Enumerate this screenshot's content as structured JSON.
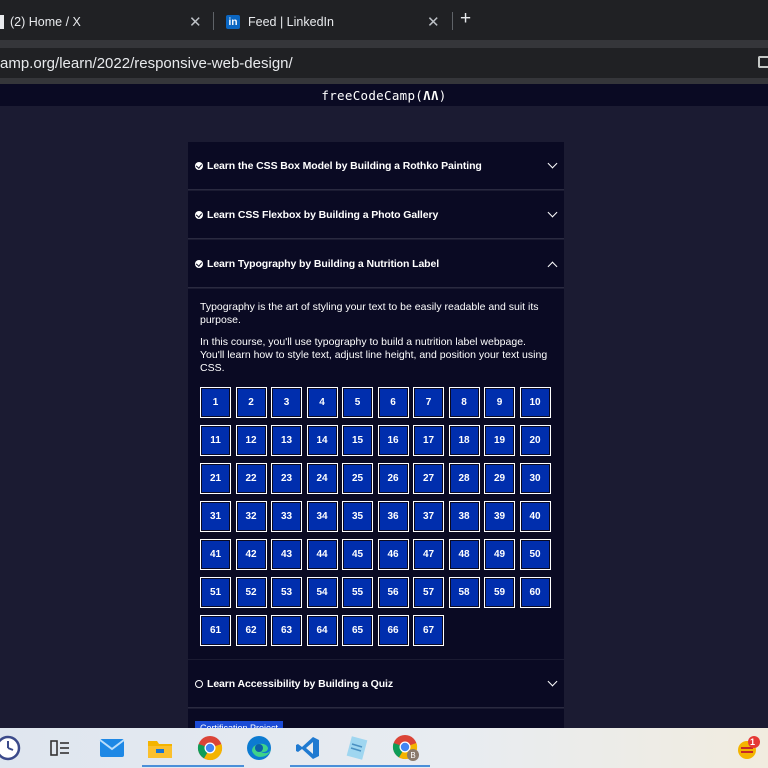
{
  "browser": {
    "tabs": [
      {
        "title": "(2) Home / X",
        "icon": "x-logo-icon"
      },
      {
        "title": "Feed | LinkedIn",
        "icon": "linkedin-icon"
      }
    ],
    "url": "amp.org/learn/2022/responsive-web-design/"
  },
  "site": {
    "logo": "freeCodeCamp(🔥)"
  },
  "blocks": [
    {
      "title": "Learn the CSS Box Model by Building a Rothko Painting",
      "status": "complete",
      "expanded": false
    },
    {
      "title": "Learn CSS Flexbox by Building a Photo Gallery",
      "status": "complete",
      "expanded": false
    },
    {
      "title": "Learn Typography by Building a Nutrition Label",
      "status": "complete",
      "expanded": true,
      "description": [
        "Typography is the art of styling your text to be easily readable and suit its purpose.",
        "In this course, you'll use typography to build a nutrition label webpage. You'll learn how to style text, adjust line height, and position your text using CSS."
      ],
      "steps": [
        "1",
        "2",
        "3",
        "4",
        "5",
        "6",
        "7",
        "8",
        "9",
        "10",
        "11",
        "12",
        "13",
        "14",
        "15",
        "16",
        "17",
        "18",
        "19",
        "20",
        "21",
        "22",
        "23",
        "24",
        "25",
        "26",
        "27",
        "28",
        "29",
        "30",
        "31",
        "32",
        "33",
        "34",
        "35",
        "36",
        "37",
        "38",
        "39",
        "40",
        "41",
        "42",
        "43",
        "44",
        "45",
        "46",
        "47",
        "48",
        "49",
        "50",
        "51",
        "52",
        "53",
        "54",
        "55",
        "56",
        "57",
        "58",
        "59",
        "60",
        "61",
        "62",
        "63",
        "64",
        "65",
        "66",
        "67"
      ]
    },
    {
      "title": "Learn Accessibility by Building a Quiz",
      "status": "incomplete",
      "expanded": false
    }
  ],
  "certification": {
    "label": "Certification Project"
  },
  "colors": {
    "bg": "#1b1b32",
    "panel": "#0a0a23",
    "step": "#002ead",
    "badge": "#1b4bd6"
  },
  "taskbar": {
    "apps": [
      "task-view-icon",
      "mail-icon",
      "file-explorer-icon",
      "chrome-icon",
      "edge-icon",
      "vscode-icon",
      "notepad-icon",
      "chrome-profile-icon"
    ],
    "notification_count": "1"
  }
}
